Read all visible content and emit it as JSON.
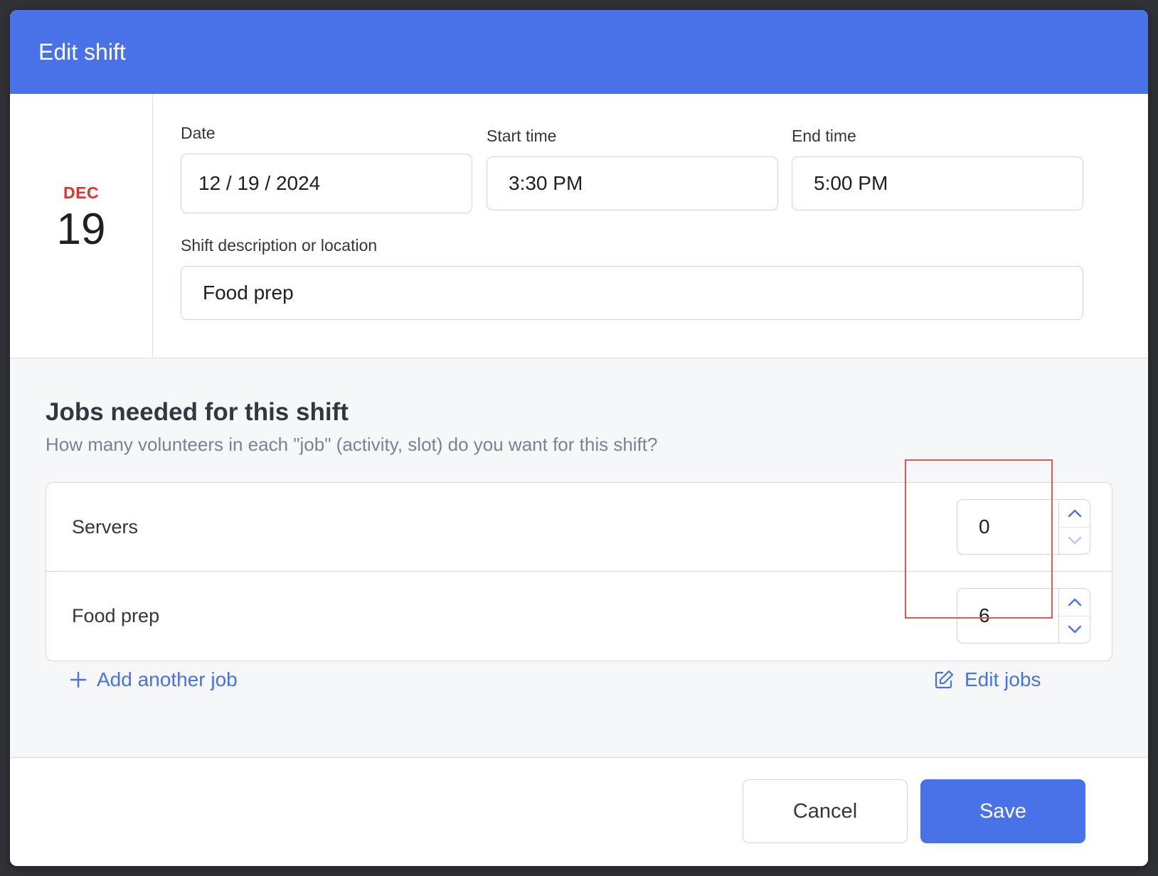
{
  "modal": {
    "title": "Edit shift"
  },
  "date_badge": {
    "month": "DEC",
    "day": "19"
  },
  "fields": {
    "date_label": "Date",
    "date_value": "12 / 19 / 2024",
    "start_label": "Start time",
    "start_value": "3:30 PM",
    "end_label": "End time",
    "end_value": "5:00 PM",
    "description_label": "Shift description or location",
    "description_value": "Food prep"
  },
  "jobs": {
    "title": "Jobs needed for this shift",
    "subtitle": "How many volunteers in each \"job\" (activity, slot) do you want for this shift?",
    "items": [
      {
        "name": "Servers",
        "count": "0"
      },
      {
        "name": "Food prep",
        "count": "6"
      }
    ],
    "add_label": "Add another job",
    "edit_label": "Edit jobs"
  },
  "footer": {
    "cancel_label": "Cancel",
    "save_label": "Save"
  },
  "colors": {
    "accent": "#4a72e8",
    "month_red": "#e0332b",
    "highlight": "#e5574a"
  },
  "icons": {
    "add": "plus-icon",
    "edit": "edit-pencil-icon",
    "up": "chevron-up-icon",
    "down": "chevron-down-icon"
  }
}
